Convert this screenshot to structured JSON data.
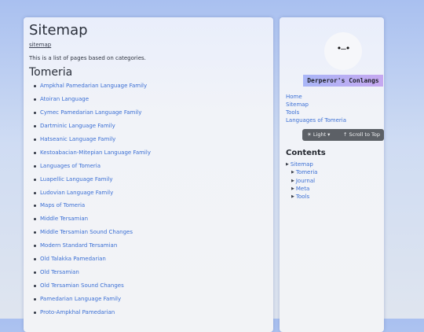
{
  "main": {
    "title": "Sitemap",
    "breadcrumb": "sitemap",
    "intro": "This is a list of pages based on categories.",
    "section_title": "Tomeria",
    "pages": [
      "Ampkhal Pamedarian Language Family",
      "Atoiran Language",
      "Cymec Pamedarian Language Family",
      "Dartminic Language Family",
      "Hatseanic Language Family",
      "Kestoabacian-Mitepian Language Family",
      "Languages of Tomeria",
      "Luapellic Language Family",
      "Ludovian Language Family",
      "Maps of Tomeria",
      "Middle Tersamian",
      "Middle Tersamian Sound Changes",
      "Modern Standard Tersamian",
      "Old Talakka Pamedarian",
      "Old Tersamian",
      "Old Tersamian Sound Changes",
      "Pamedarian Language Family",
      "Proto-Ampkhal Pamedarian"
    ]
  },
  "sidebar": {
    "logo_face": "•—•",
    "brand": "Derperor's Conlangs",
    "nav": [
      "Home",
      "Sitemap",
      "Tools",
      "Languages of Tomeria"
    ],
    "controls": {
      "light_label": "☀ Light ▾",
      "scroll_label": "↑ Scroll to Top"
    },
    "contents_title": "Contents",
    "toc": {
      "root": "Sitemap",
      "children": [
        "Tomeria",
        "Journal",
        "Meta",
        "Tools"
      ]
    }
  },
  "colors": {
    "link": "#3b6fd4",
    "brand_gradient_start": "#a9b6f7",
    "brand_gradient_end": "#c6a8f0",
    "controls_bg": "#5c6066"
  }
}
